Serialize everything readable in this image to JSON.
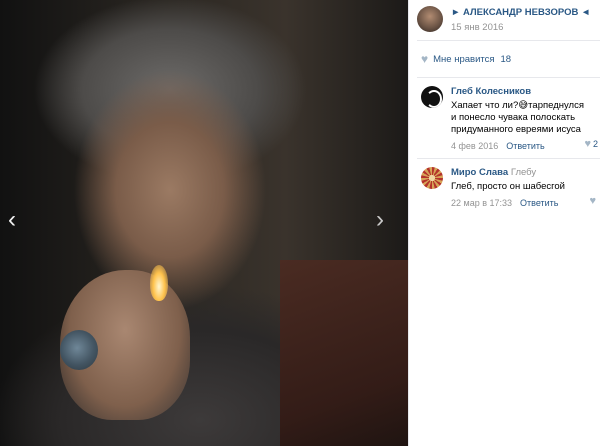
{
  "post": {
    "author": "► АЛЕКСАНДР НЕВЗОРОВ ◄",
    "date": "15 янв 2016"
  },
  "likes": {
    "label": "Мне нравится",
    "count": "18"
  },
  "comments": [
    {
      "author": "Глеб Колесников",
      "reply_to": "",
      "text": "Хапает что ли?😅тарпеднулся и понесло чувака полоскать придуманного евреями исуса",
      "date": "4 фев 2016",
      "reply_label": "Ответить",
      "likes": "2"
    },
    {
      "author": "Миро Слава",
      "reply_to": "Глебу",
      "text": "Глеб, просто он шабесгой",
      "date": "22 мар в 17:33",
      "reply_label": "Ответить",
      "likes": ""
    }
  ],
  "icons": {
    "prev": "‹",
    "next": "›",
    "heart": "♥"
  },
  "colors": {
    "link": "#2a5885",
    "muted": "#939393",
    "heart": "#a4b6c6"
  }
}
